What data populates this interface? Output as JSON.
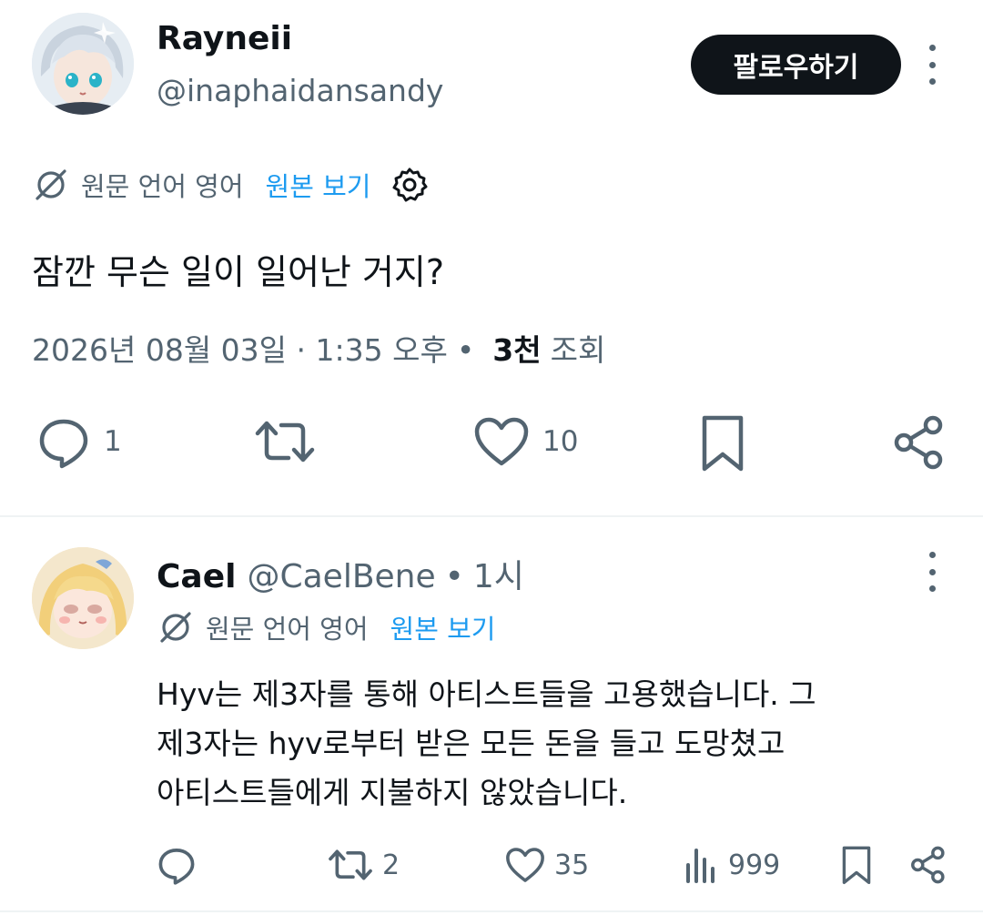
{
  "tweet": {
    "author": {
      "display_name": "Rayneii",
      "handle": "@inaphaidansandy",
      "avatar_icon": "avatar-anime-silver-hair"
    },
    "follow_label": "팔로우하기",
    "translate": {
      "language_note": "원문 언어 영어",
      "view_original": "원본 보기",
      "settings_icon": "gear-icon"
    },
    "text": "잠깐 무슨 일이 일어난 거지?",
    "meta": {
      "timestamp": "2026년 08월 03일 · 1:35 오후",
      "dot": "•",
      "views_count": "3천",
      "views_label": "조회"
    },
    "actions": {
      "reply_count": "1",
      "retweet_count": "",
      "like_count": "10"
    }
  },
  "reply": {
    "author": {
      "display_name": "Cael",
      "handle": "@CaelBene",
      "dot": "•",
      "time": "1시",
      "avatar_icon": "avatar-anime-blonde-chibi"
    },
    "translate": {
      "language_note": "원문 언어 영어",
      "view_original": "원본 보기"
    },
    "text_lines": [
      "Hyv는 제3자를 통해 아티스트들을 고용했습니다. 그",
      "제3자는 hyv로부터 받은 모든 돈을 들고 도망쳤고",
      "아티스트들에게 지불하지 않았습니다."
    ],
    "actions": {
      "reply_count": "",
      "retweet_count": "2",
      "like_count": "35",
      "views_count": "999"
    }
  },
  "colors": {
    "text_primary": "#0f1419",
    "text_secondary": "#536471",
    "link": "#1d9bf0",
    "divider": "#eff3f4"
  }
}
